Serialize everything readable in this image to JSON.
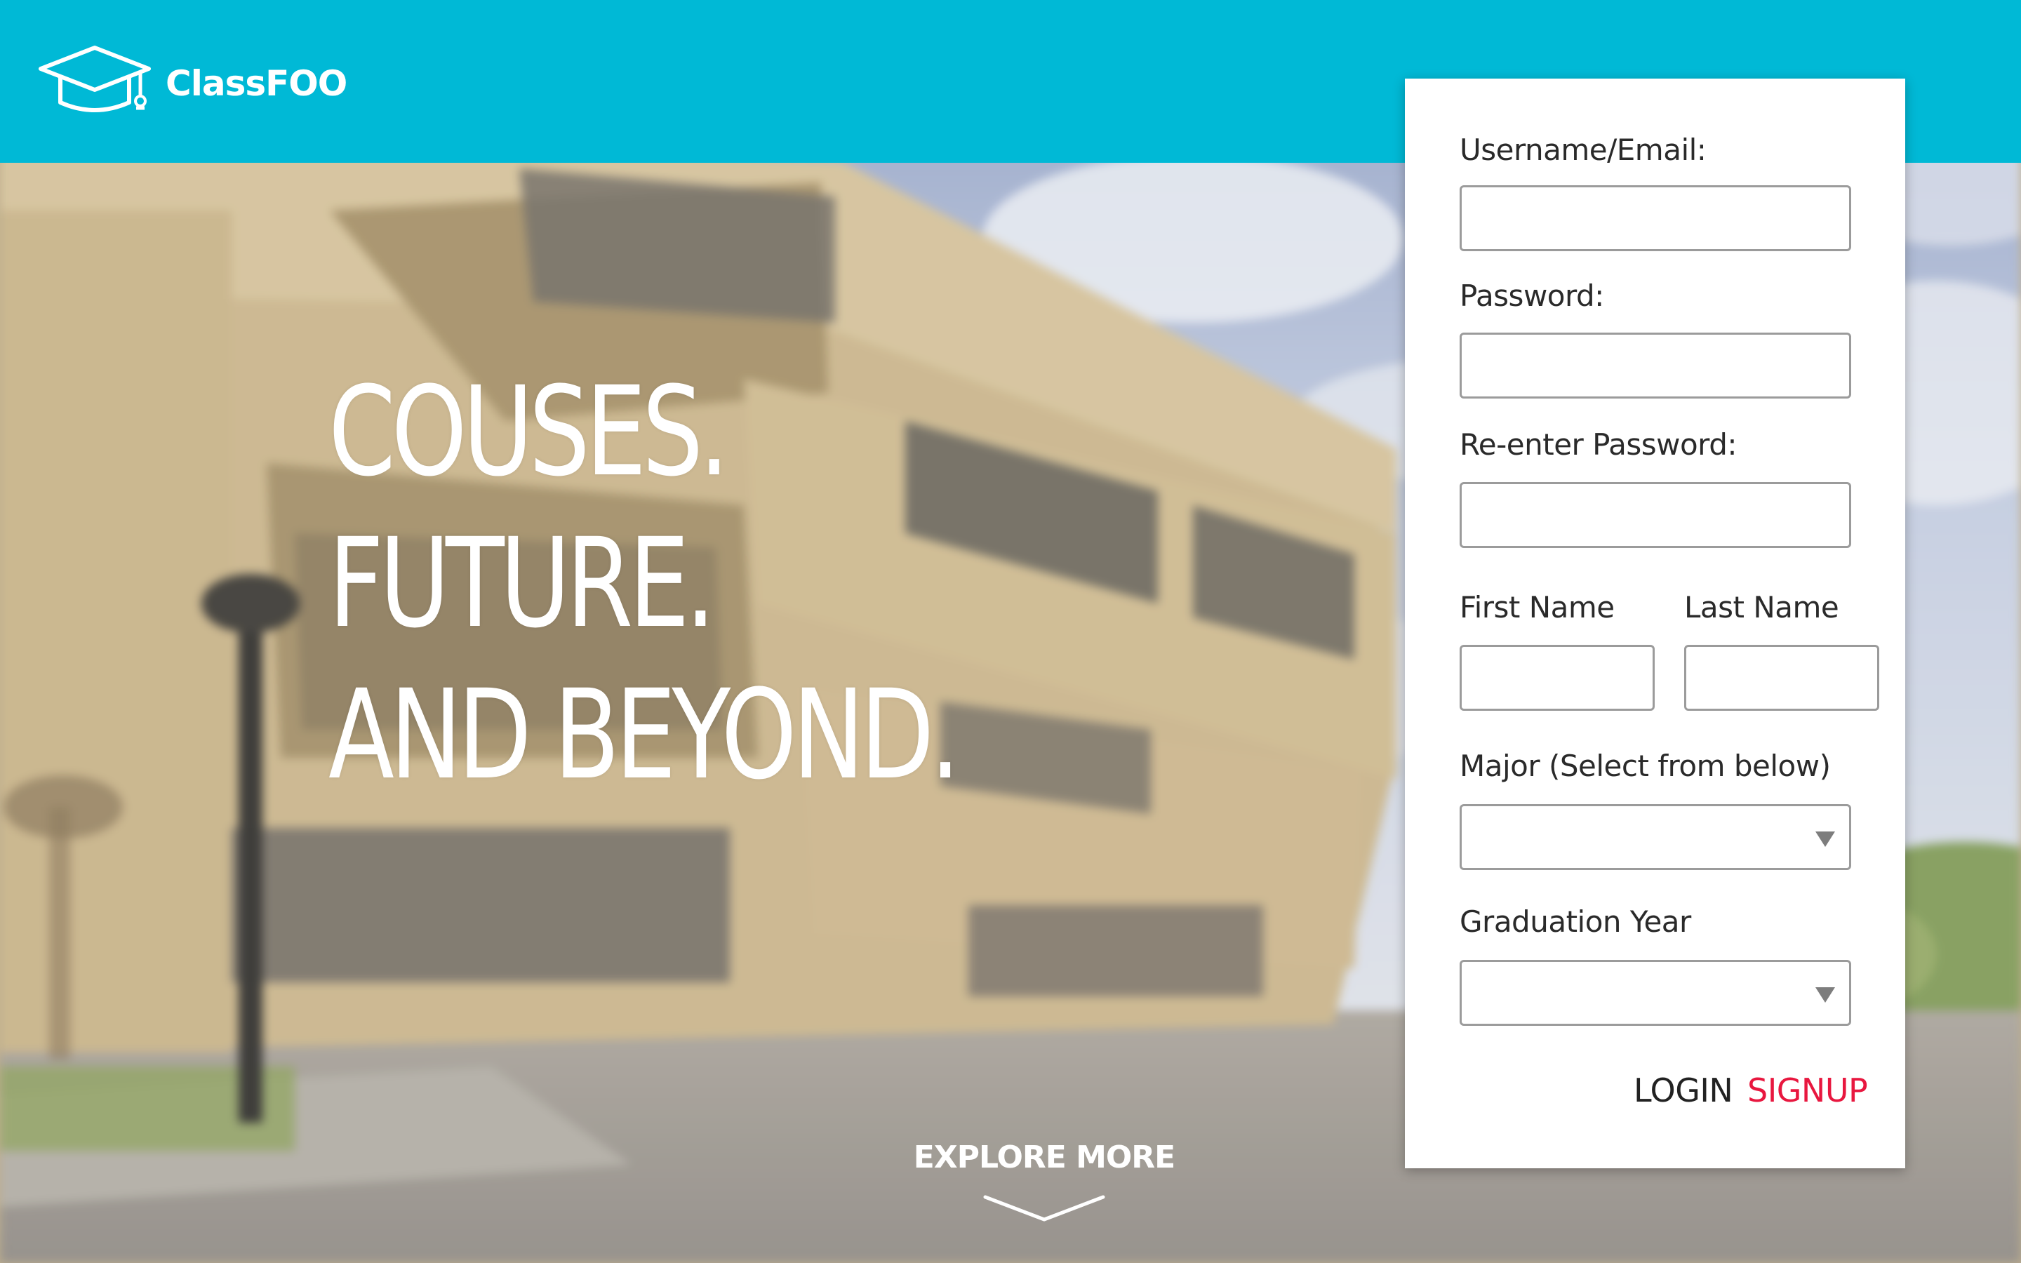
{
  "colors": {
    "header_bg": "#00b9d6",
    "accent_signup": "#e8173f",
    "card_bg": "#ffffff",
    "input_border": "#9b9b9b"
  },
  "header": {
    "logo_icon": "graduation-cap-icon",
    "brand": "ClassFOO"
  },
  "hero": {
    "lines": [
      "COUSES.",
      "FUTURE.",
      "AND BEYOND."
    ],
    "explore_label": "EXPLORE MORE",
    "explore_icon": "chevron-down-icon"
  },
  "signup_form": {
    "username_label": "Username/Email:",
    "username_value": "",
    "password_label": "Password:",
    "password_value": "",
    "reenter_password_label": "Re-enter Password:",
    "reenter_password_value": "",
    "first_name_label": "First Name",
    "first_name_value": "",
    "last_name_label": "Last Name",
    "last_name_value": "",
    "major_label": "Major (Select from below)",
    "major_value": "",
    "graduation_year_label": "Graduation Year",
    "graduation_year_value": "",
    "dropdown_icon": "caret-down-icon",
    "login_label": "LOGIN",
    "signup_label": "SIGNUP"
  }
}
